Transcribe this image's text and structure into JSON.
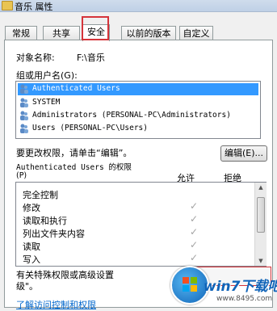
{
  "window": {
    "title": "音乐 属性"
  },
  "tabs": [
    {
      "label": "常规"
    },
    {
      "label": "共享"
    },
    {
      "label": "安全"
    },
    {
      "label": "以前的版本"
    },
    {
      "label": "自定义"
    }
  ],
  "security": {
    "object_label": "对象名称:",
    "object_value": "F:\\音乐",
    "groups_label": "组或用户名(G):",
    "groups": [
      {
        "label": "Authenticated Users",
        "selected": true
      },
      {
        "label": "SYSTEM",
        "selected": false
      },
      {
        "label": "Administrators (PERSONAL-PC\\Administrators)",
        "selected": false
      },
      {
        "label": "Users (PERSONAL-PC\\Users)",
        "selected": false
      }
    ],
    "change_hint": "要更改权限，请单击“编辑”。",
    "edit_button": "编辑(E)...",
    "permissions_header_line1": "Authenticated Users 的权限",
    "permissions_header_line2": "(P)",
    "allow_label": "允许",
    "deny_label": "拒绝",
    "permissions": [
      {
        "name": "完全控制",
        "allow": false
      },
      {
        "name": "修改",
        "allow": true
      },
      {
        "name": "读取和执行",
        "allow": true
      },
      {
        "name": "列出文件夹内容",
        "allow": true
      },
      {
        "name": "读取",
        "allow": true
      },
      {
        "name": "写入",
        "allow": true
      }
    ],
    "special_hint_line1": "有关特殊权限或高级设置",
    "special_hint_line2": "级\"。",
    "access_link": "了解访问控制和权限"
  },
  "watermark": {
    "brand": "win7下载吧",
    "url": "www.8495.com"
  },
  "colors": {
    "selection": "#3399ff",
    "highlight_red": "#d5343a",
    "link": "#0066cc"
  }
}
